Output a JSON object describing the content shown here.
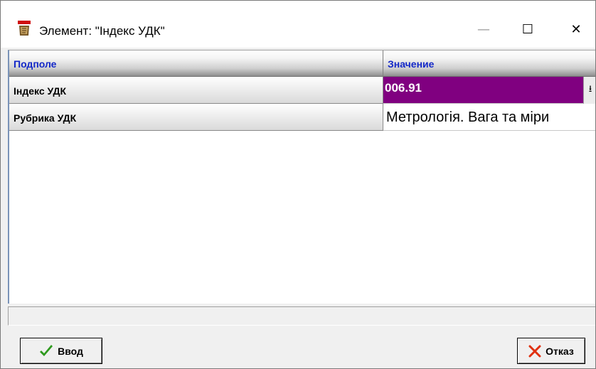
{
  "window": {
    "title": "Элемент: \"Індекс УДК\"",
    "minimize_glyph": "—",
    "maximize_glyph": "☐",
    "close_glyph": "✕"
  },
  "grid": {
    "columns": [
      "Подполе",
      "Значение"
    ],
    "rows": [
      {
        "field": "Індекс УДК",
        "value": "006.91",
        "selected": true
      },
      {
        "field": "Рубрика УДК",
        "value": "Метрологія. Вага та міри",
        "selected": false
      }
    ],
    "dropdown_glyph": "⭳"
  },
  "status": {
    "text": ""
  },
  "buttons": {
    "ok_label": "Ввод",
    "cancel_label": "Отказ"
  },
  "colors": {
    "selection": "#800080",
    "header_text": "#1428c8",
    "ok_icon": "#2e9a1e",
    "cancel_icon": "#e03010"
  },
  "icons": {
    "app": "irbis-app-icon",
    "ok": "checkmark-icon",
    "cancel": "x-mark-icon",
    "dropdown": "dropdown-arrow-icon"
  }
}
